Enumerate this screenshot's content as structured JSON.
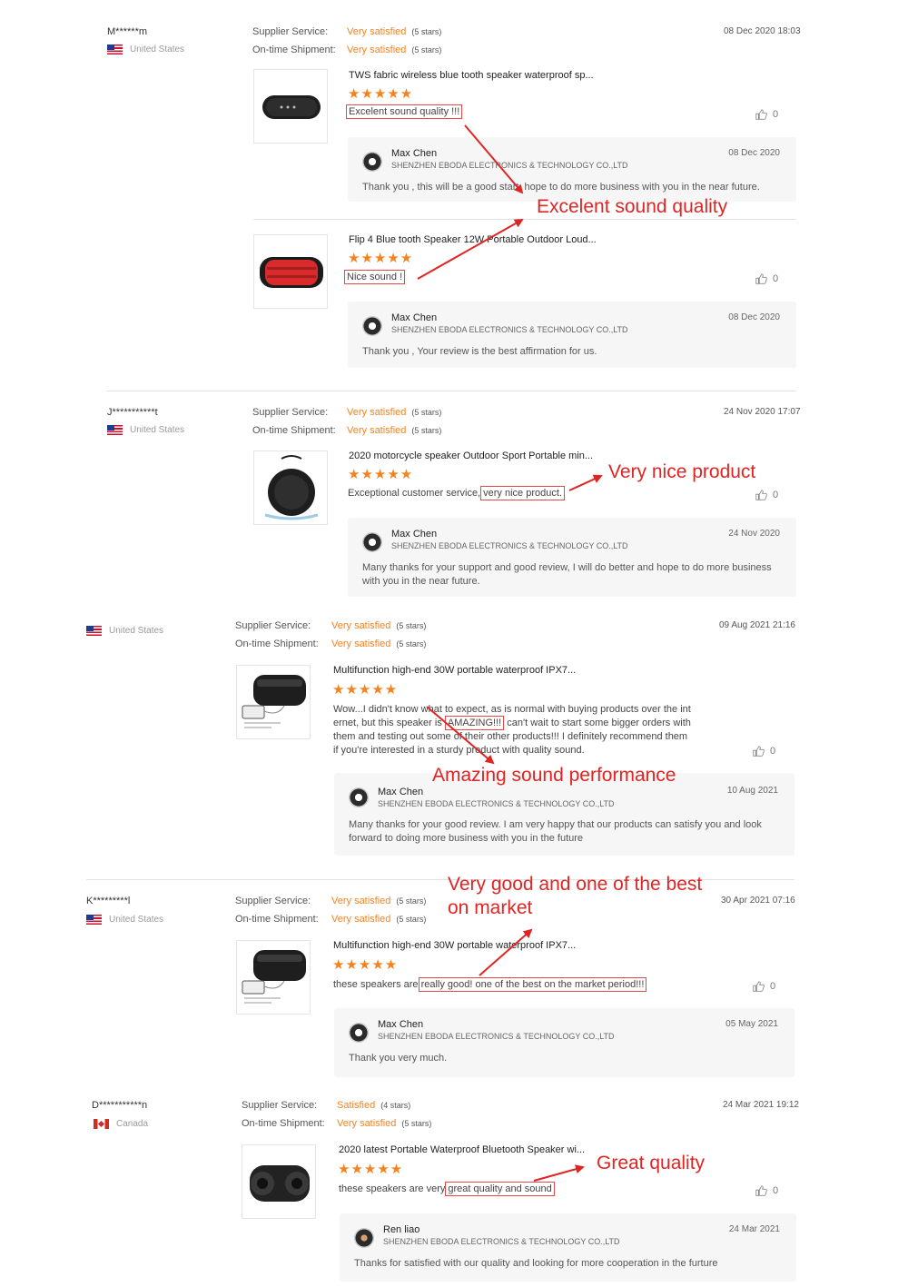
{
  "labels": {
    "service": "Supplier Service:",
    "shipment": "On-time Shipment:"
  },
  "colors": {
    "accent": "#f5821f",
    "callout": "#e02424"
  },
  "callouts": {
    "c1": "Excelent sound quality",
    "c2": "Very nice product",
    "c3": "Amazing sound performance",
    "c4a": "Very good and one of the best",
    "c4b": "on market",
    "c5": "Great quality"
  },
  "reviews": [
    {
      "buyer": "M******m",
      "country": "United States",
      "date": "08 Dec 2020 18:03",
      "service": "Very satisfied",
      "service_stars": "(5 stars)",
      "shipment": "Very satisfied",
      "shipment_stars": "(5 stars)",
      "items": [
        {
          "product": "TWS fabric wireless blue tooth speaker waterproof sp...",
          "stars": "★★★★★",
          "text_hl": "Excelent sound quality !!!",
          "likes": "0",
          "reply": {
            "seller": "Max Chen",
            "company": "SHENZHEN EBODA ELECTRONICS & TECHNOLOGY CO.,LTD",
            "date": "08 Dec 2020",
            "text": "Thank you , this  will be a good start, hope to do more business with you in the near future."
          }
        },
        {
          "product": "Flip 4 Blue tooth Speaker 12W Portable Outdoor Loud...",
          "stars": "★★★★★",
          "text_hl": "Nice sound !",
          "likes": "0",
          "reply": {
            "seller": "Max Chen",
            "company": "SHENZHEN EBODA ELECTRONICS & TECHNOLOGY CO.,LTD",
            "date": "08 Dec 2020",
            "text": "Thank you , Your review is the best affirmation for us."
          }
        }
      ]
    },
    {
      "buyer": "J***********t",
      "country": "United States",
      "date": "24 Nov 2020 17:07",
      "service": "Very satisfied",
      "service_stars": "(5 stars)",
      "shipment": "Very satisfied",
      "shipment_stars": "(5 stars)",
      "product": "2020 motorcycle speaker Outdoor Sport Portable min...",
      "stars": "★★★★★",
      "text_pre": "Exceptional customer service,",
      "text_hl": "very nice product.",
      "likes": "0",
      "reply": {
        "seller": "Max Chen",
        "company": "SHENZHEN EBODA ELECTRONICS & TECHNOLOGY CO.,LTD",
        "date": "24 Nov 2020",
        "text_1": "Many thanks for your support and good review, I will do better and hope to do more business",
        "text_2": "with you in the near future."
      }
    },
    {
      "country": "United States",
      "date": "09 Aug 2021 21:16",
      "service": "Very satisfied",
      "service_stars": "(5 stars)",
      "shipment": "Very satisfied",
      "shipment_stars": "(5 stars)",
      "product": "Multifunction high-end 30W portable waterproof IPX7...",
      "stars": "★★★★★",
      "line1": "Wow...I didn't know what to expect, as is normal with buying products over the int",
      "line2_pre": "ernet, but this speaker is",
      "line2_hl": "AMAZING!!!",
      "line2_post": "can't wait to start some bigger orders with",
      "line3": "them and testing out some of their other products!!! I definitely recommend them",
      "line4": "if you're interested in a sturdy product with quality sound.",
      "likes": "0",
      "reply": {
        "seller": "Max Chen",
        "company": "SHENZHEN EBODA ELECTRONICS & TECHNOLOGY CO.,LTD",
        "date": "10 Aug 2021",
        "text_1": "Many thanks for your good review. I am very happy that our products can satisfy you and look",
        "text_2": "forward to doing more business with you in the future"
      }
    },
    {
      "buyer": "K*********l",
      "country": "United States",
      "date": "30 Apr 2021 07:16",
      "service": "Very satisfied",
      "service_stars": "(5 stars)",
      "shipment": "Very satisfied",
      "shipment_stars": "(5 stars)",
      "product": "Multifunction high-end 30W portable waterproof IPX7...",
      "stars": "★★★★★",
      "text_pre": "these speakers are",
      "text_hl": "really good! one of the best on the market period!!!",
      "likes": "0",
      "reply": {
        "seller": "Max Chen",
        "company": "SHENZHEN EBODA ELECTRONICS & TECHNOLOGY CO.,LTD",
        "date": "05 May 2021",
        "text": "Thank you very much."
      }
    },
    {
      "buyer": "D***********n",
      "country": "Canada",
      "date": "24 Mar 2021 19:12",
      "service": "Satisfied",
      "service_stars": "(4 stars)",
      "shipment": "Very satisfied",
      "shipment_stars": "(5 stars)",
      "product": "2020 latest Portable Waterproof Bluetooth Speaker wi...",
      "stars": "★★★★★",
      "text_pre": "these speakers are very",
      "text_hl": "great quality and sound",
      "likes": "0",
      "reply": {
        "seller": "Ren liao",
        "company": "SHENZHEN EBODA ELECTRONICS & TECHNOLOGY CO.,LTD",
        "date": "24 Mar 2021",
        "text": "Thanks for satisfied with our quality and looking for more cooperation in the furture"
      }
    }
  ]
}
